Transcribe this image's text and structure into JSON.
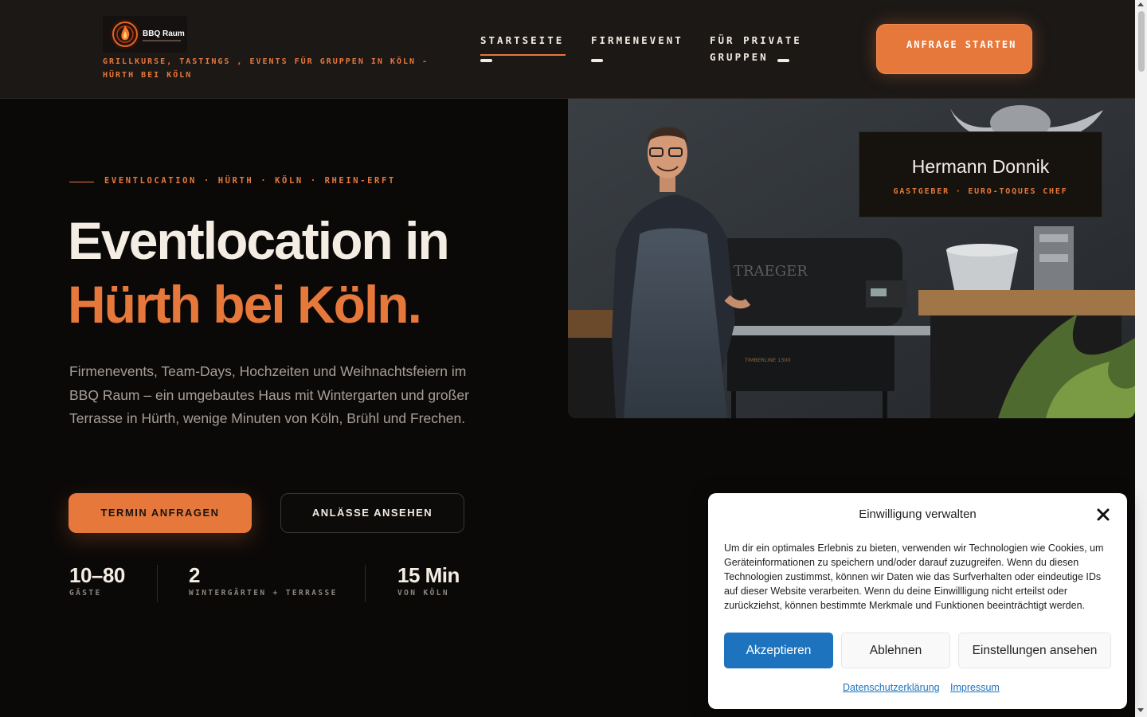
{
  "header": {
    "logo_text": "BBQ Raum",
    "tagline": "GRILLKURSE, TASTINGS , EVENTS FÜR GRUPPEN IN KÖLN - HÜRTH BEI KÖLN",
    "nav": [
      {
        "label": "STARTSEITE",
        "active": true
      },
      {
        "label": "FIRMENEVENT",
        "active": false
      },
      {
        "label": "FÜR PRIVATE GRUPPEN",
        "active": false
      }
    ],
    "cta_label": "ANFRAGE STARTEN"
  },
  "hero": {
    "eyebrow": "EVENTLOCATION · HÜRTH · KÖLN · RHEIN-ERFT",
    "title_line1": "Eventlocation in",
    "title_line2": "Hürth bei Köln.",
    "lead": "Firmenevents, Team-Days, Hochzeiten und Weihnachtsfeiern im BBQ Raum – ein umgebautes Haus mit Wintergarten und großer Terrasse in Hürth, wenige Minuten von Köln, Brühl und Frechen.",
    "primary_button": "TERMIN ANFRAGEN",
    "secondary_button": "ANLÄSSE ANSEHEN",
    "stats": [
      {
        "value": "10–80",
        "label": "GÄSTE"
      },
      {
        "value": "2",
        "label": "WINTERGÄRTEN + TERRASSE"
      },
      {
        "value": "15 Min",
        "label": "VON KÖLN"
      }
    ]
  },
  "host_card": {
    "name": "Hermann Donnik",
    "role": "GASTGEBER · EURO-TOQUES CHEF"
  },
  "photo": {
    "grill_brand": "TRAEGER",
    "grill_model": "TIMBERLINE 1300"
  },
  "cookie_dialog": {
    "title": "Einwilligung verwalten",
    "text": "Um dir ein optimales Erlebnis zu bieten, verwenden wir Technologien wie Cookies, um Geräteinformationen zu speichern und/oder darauf zuzugreifen. Wenn du diesen Technologien zustimmst, können wir Daten wie das Surfverhalten oder eindeutige IDs auf dieser Website verarbeiten. Wenn du deine Einwillligung nicht erteilst oder zurückziehst, können bestimmte Merkmale und Funktionen beeinträchtigt werden.",
    "accept": "Akzeptieren",
    "deny": "Ablehnen",
    "preferences": "Einstellungen ansehen",
    "privacy_link": "Datenschutzerklärung",
    "imprint_link": "Impressum"
  },
  "colors": {
    "accent": "#e6783c",
    "background": "#0b0908",
    "header": "#1b1816",
    "cookie_primary": "#1e73be"
  }
}
